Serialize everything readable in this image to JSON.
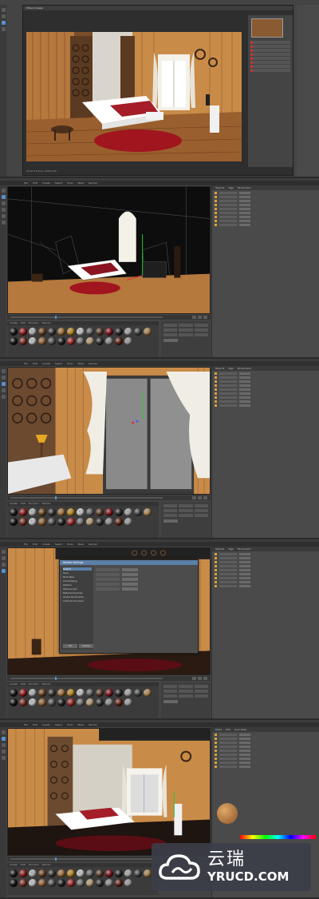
{
  "window": {
    "title": "Cinema 4D"
  },
  "render_view": {
    "title": "Picture Viewer",
    "status": "00:01:23 Size: 1280x720"
  },
  "panels": [
    {
      "id": "p1",
      "label": "render"
    },
    {
      "id": "p2",
      "label": "wireframe"
    },
    {
      "id": "p3",
      "label": "window"
    },
    {
      "id": "p4",
      "label": "dialog"
    },
    {
      "id": "p5",
      "label": "shaded"
    }
  ],
  "material_tabs": [
    "Create",
    "Edit",
    "Function",
    "Texture"
  ],
  "right_tabs": [
    "Objects",
    "Tags",
    "Bookmarks"
  ],
  "attr_tabs": [
    "Mode",
    "Edit",
    "User Data"
  ],
  "dialog": {
    "title": "Render Settings",
    "items": [
      "Output",
      "Save",
      "Multi-Pass",
      "Anti-Aliasing",
      "Options",
      "Stereoscopic",
      "Material Override",
      "Global Illumination",
      "Ambient Occlusion"
    ],
    "ok": "OK",
    "cancel": "Cancel"
  },
  "watermark": {
    "cn": "云瑞",
    "en": "YRUCD.COM"
  },
  "colors": {
    "accent": "#5b8fc9",
    "wood": "#c98b48",
    "rug": "#a01820"
  }
}
